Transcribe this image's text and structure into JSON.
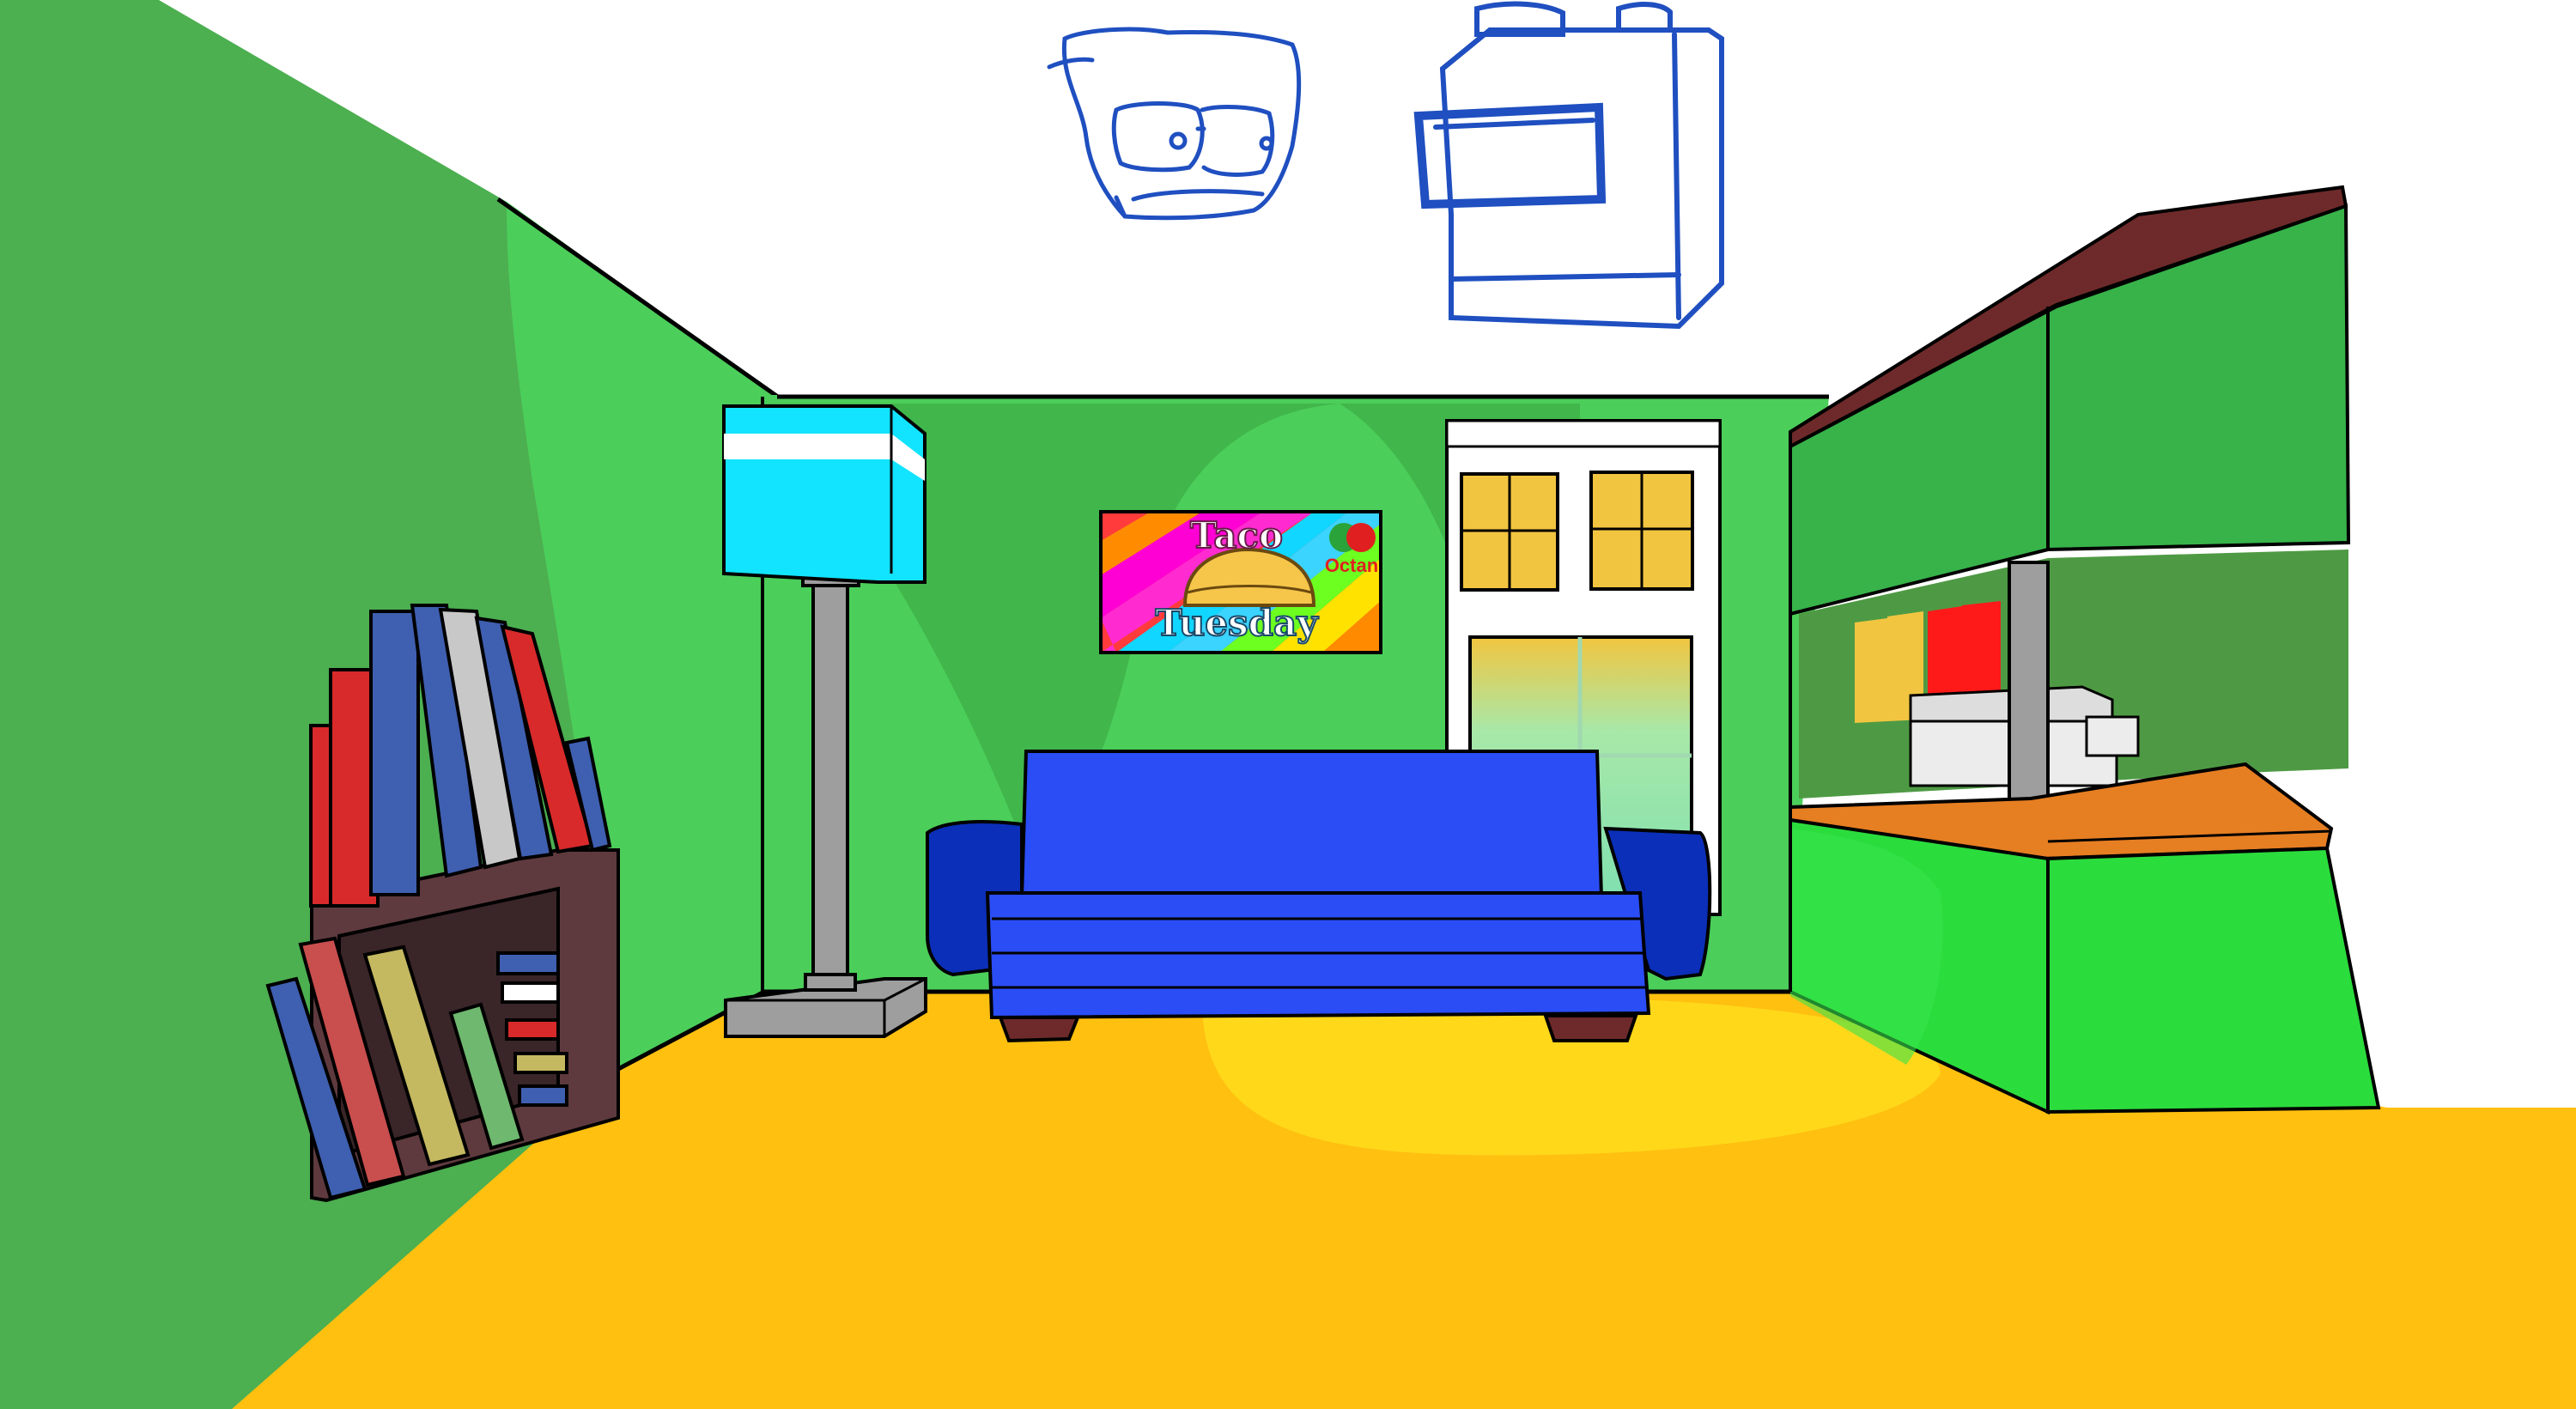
{
  "scene": {
    "poster": {
      "line1": "Taco",
      "line2": "Tuesday",
      "brand": "Octan"
    },
    "colors": {
      "background": "#ffffff",
      "wall_left": "#4caf50",
      "wall_back": "#4cce5a",
      "wall_shadow": "#3fb449",
      "floor": "#ffc010",
      "floor_light": "#ffd81a",
      "couch": "#2a4df5",
      "couch_dark": "#0b2fb8",
      "lamp_shade": "#12e4ff",
      "lamp_pole": "#9e9e9e",
      "bookshelf": "#5e3a3e",
      "door_window": "#f2c540",
      "counter_top": "#e67e22",
      "cabinet": "#37b34a",
      "cabinet_front": "#2bdc3d",
      "roof_trim": "#6e2a2a",
      "sketch": "#1f4fc0"
    }
  }
}
